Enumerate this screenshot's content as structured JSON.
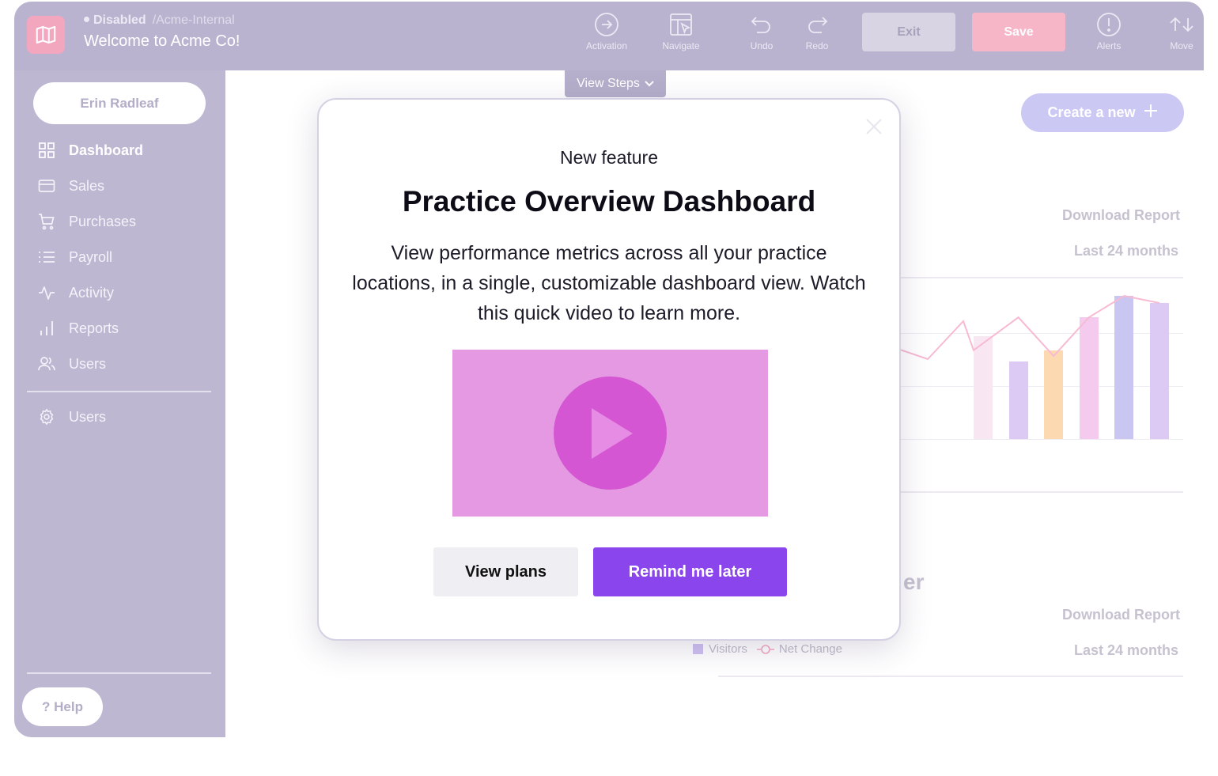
{
  "header": {
    "status": "Disabled",
    "path": "/Acme-Internal",
    "title": "Welcome to Acme Co!",
    "tools": [
      {
        "label": "Activation",
        "icon": "arrow-circle-icon"
      },
      {
        "label": "Navigate",
        "icon": "navigate-cursor-icon"
      },
      {
        "label": "Undo",
        "icon": "undo-icon"
      },
      {
        "label": "Redo",
        "icon": "redo-icon"
      },
      {
        "label": "Alerts",
        "icon": "alert-circle-icon"
      },
      {
        "label": "Move",
        "icon": "move-arrows-icon"
      }
    ],
    "exit_label": "Exit",
    "save_label": "Save"
  },
  "sidebar": {
    "user_name": "Erin Radleaf",
    "items": [
      {
        "label": "Dashboard",
        "icon": "grid-icon",
        "active": true
      },
      {
        "label": "Sales",
        "icon": "card-icon"
      },
      {
        "label": "Purchases",
        "icon": "cart-icon"
      },
      {
        "label": "Payroll",
        "icon": "list-icon"
      },
      {
        "label": "Activity",
        "icon": "pulse-icon"
      },
      {
        "label": "Reports",
        "icon": "bar-chart-icon"
      },
      {
        "label": "Users",
        "icon": "users-icon"
      }
    ],
    "settings_item": {
      "label": "Users",
      "icon": "gear-icon"
    },
    "help_label": "? Help"
  },
  "main": {
    "view_steps_label": "View Steps",
    "create_label": "Create a new",
    "section1": {
      "download_label": "Download Report",
      "range_label": "Last 24 months"
    },
    "section2": {
      "title_fragment": "er",
      "download_label": "Download Report",
      "range_label": "Last 24 months",
      "legend": [
        "Visitors",
        "Net Change"
      ]
    }
  },
  "chart_data": {
    "type": "bar",
    "note_visibility": "partially obscured by modal",
    "series": [
      {
        "name": "Visitors",
        "values": [
          0.72,
          0.54,
          0.62,
          0.85,
          1.0,
          0.95
        ]
      },
      {
        "name": "Net Change",
        "values": [
          0.62,
          0.85,
          0.58,
          0.85,
          1.0,
          0.95
        ]
      }
    ],
    "colors": [
      "#f9e6f3",
      "#dccaf5",
      "#fdd9b1",
      "#f4cbef",
      "#c9c7f2",
      "#dccaf5"
    ],
    "line_color": "#f7bad2"
  },
  "modal": {
    "kicker": "New feature",
    "title": "Practice Overview Dashboard",
    "body": "View performance metrics across all your practice locations, in a single, customizable dashboard view. Watch this quick video to learn more.",
    "secondary_label": "View plans",
    "primary_label": "Remind me later",
    "accent": "#8b45ed",
    "video_bg": "#e499e2"
  }
}
